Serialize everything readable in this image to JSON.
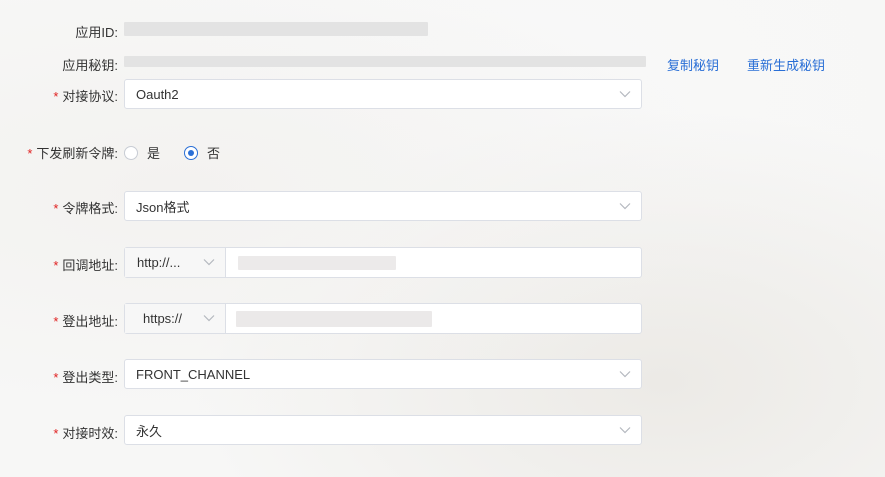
{
  "app_id": {
    "label": "应用ID:"
  },
  "app_secret": {
    "label": "应用秘钥:",
    "copy_label": "复制秘钥",
    "regen_label": "重新生成秘钥"
  },
  "protocol": {
    "label": "对接协议:",
    "value": "Oauth2"
  },
  "refresh_token": {
    "label": "下发刷新令牌:",
    "options": [
      "是",
      "否"
    ],
    "selected": "否"
  },
  "token_format": {
    "label": "令牌格式:",
    "value": "Json格式"
  },
  "callback": {
    "label": "回调地址:",
    "scheme": "http://..."
  },
  "logout_url": {
    "label": "登出地址:",
    "scheme": "https://"
  },
  "logout_type": {
    "label": "登出类型:",
    "value": "FRONT_CHANNEL"
  },
  "validity": {
    "label": "对接时效:",
    "value": "永久"
  },
  "colors": {
    "accent": "#2a6fd6",
    "required": "#e02020"
  },
  "icons": {
    "dropdown": "chevron-down-icon"
  }
}
